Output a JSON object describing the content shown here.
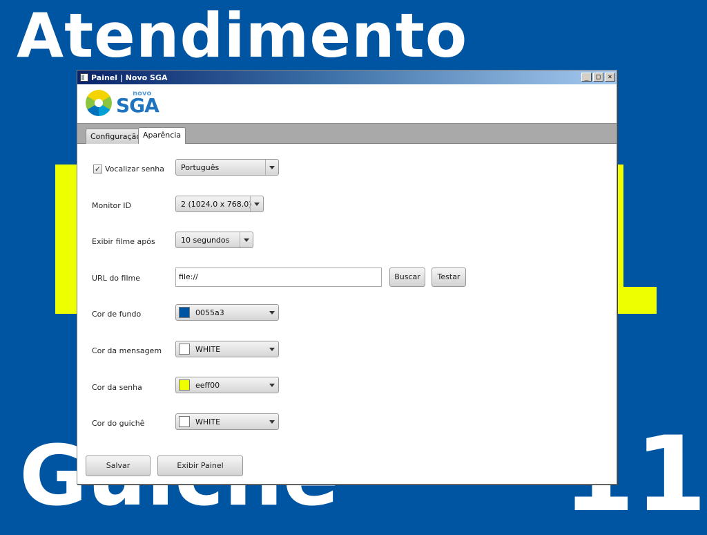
{
  "background": {
    "color": "#0055a3",
    "accent_color": "#eeff00",
    "top_title": "Atendimento",
    "bottom_title": "Guichê",
    "number": "11"
  },
  "window": {
    "title": "Painel | Novo SGA",
    "controls": [
      "_",
      "□",
      "×"
    ]
  },
  "logo": {
    "novo": "novo",
    "brand": "SGA"
  },
  "tabs": [
    {
      "label": "Configuração",
      "active": false
    },
    {
      "label": "Aparência",
      "active": true
    }
  ],
  "form": {
    "vocalizar": {
      "label": "Vocalizar senha",
      "checked": true,
      "value": "Português"
    },
    "monitor": {
      "label": "Monitor ID",
      "value": "2 (1024.0 x 768.0)"
    },
    "filme": {
      "label": "Exibir filme após",
      "value": "10 segundos"
    },
    "url": {
      "label": "URL do filme",
      "value": "file://"
    },
    "buscar_label": "Buscar",
    "testar_label": "Testar",
    "cor_fundo": {
      "label": "Cor de fundo",
      "value": "0055a3",
      "swatch": "#0055a3"
    },
    "cor_mensagem": {
      "label": "Cor da mensagem",
      "value": "WHITE",
      "swatch": "#ffffff"
    },
    "cor_senha": {
      "label": "Cor da senha",
      "value": "eeff00",
      "swatch": "#eeff00"
    },
    "cor_guiche": {
      "label": "Cor do guichê",
      "value": "WHITE",
      "swatch": "#ffffff"
    }
  },
  "footer": {
    "salvar_label": "Salvar",
    "exibir_label": "Exibir Painel"
  }
}
